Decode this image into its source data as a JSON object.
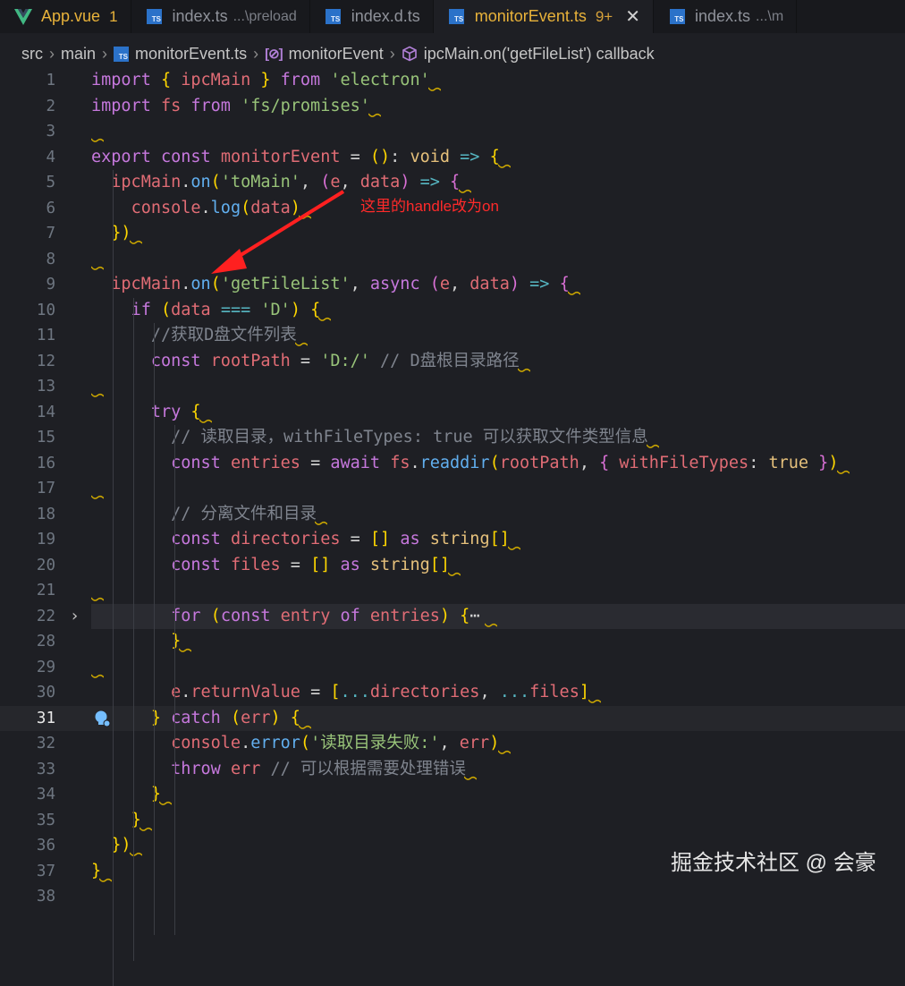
{
  "tabs": [
    {
      "title": "App.vue",
      "badge": "1",
      "icon": "vue-icon",
      "desc": "",
      "active": false
    },
    {
      "title": "index.ts",
      "badge": "",
      "icon": "ts-file-icon",
      "desc": "...\\preload",
      "active": false
    },
    {
      "title": "index.d.ts",
      "badge": "",
      "icon": "ts-file-icon",
      "desc": "",
      "active": false
    },
    {
      "title": "monitorEvent.ts",
      "badge": "9+",
      "icon": "ts-file-icon",
      "desc": "",
      "active": true
    },
    {
      "title": "index.ts",
      "badge": "",
      "icon": "ts-file-icon",
      "desc": "...\\m",
      "active": false
    }
  ],
  "ts_badge": "TS",
  "close_glyph": "✕",
  "breadcrumb": [
    "src",
    "main",
    "monitorEvent.ts",
    "monitorEvent",
    "ipcMain.on('getFileList') callback"
  ],
  "breadcrumb_sep": "›",
  "editor": {
    "current_line": "31",
    "folded_line": "22",
    "lines": [
      {
        "n": "1",
        "text": "import { ipcMain } from 'electron'"
      },
      {
        "n": "2",
        "text": "import fs from 'fs/promises'"
      },
      {
        "n": "3",
        "text": ""
      },
      {
        "n": "4",
        "text": "export const monitorEvent = (): void => {"
      },
      {
        "n": "5",
        "text": "  ipcMain.on('toMain', (e, data) => {"
      },
      {
        "n": "6",
        "text": "    console.log(data)"
      },
      {
        "n": "7",
        "text": "  })"
      },
      {
        "n": "8",
        "text": ""
      },
      {
        "n": "9",
        "text": "  ipcMain.on('getFileList', async (e, data) => {"
      },
      {
        "n": "10",
        "text": "    if (data === 'D') {"
      },
      {
        "n": "11",
        "text": "      //获取D盘文件列表"
      },
      {
        "n": "12",
        "text": "      const rootPath = 'D:/' // D盘根目录路径"
      },
      {
        "n": "13",
        "text": ""
      },
      {
        "n": "14",
        "text": "      try {"
      },
      {
        "n": "15",
        "text": "        // 读取目录，withFileTypes: true 可以获取文件类型信息"
      },
      {
        "n": "16",
        "text": "        const entries = await fs.readdir(rootPath, { withFileTypes: true })"
      },
      {
        "n": "17",
        "text": ""
      },
      {
        "n": "18",
        "text": "        // 分离文件和目录"
      },
      {
        "n": "19",
        "text": "        const directories = [] as string[]"
      },
      {
        "n": "20",
        "text": "        const files = [] as string[]"
      },
      {
        "n": "21",
        "text": ""
      },
      {
        "n": "22",
        "text": "        for (const entry of entries) {⋯"
      },
      {
        "n": "28",
        "text": "        }"
      },
      {
        "n": "29",
        "text": ""
      },
      {
        "n": "30",
        "text": "        e.returnValue = [...directories, ...files]"
      },
      {
        "n": "31",
        "text": "      } catch (err) {"
      },
      {
        "n": "32",
        "text": "        console.error('读取目录失败:', err)"
      },
      {
        "n": "33",
        "text": "        throw err // 可以根据需要处理错误"
      },
      {
        "n": "34",
        "text": "      }"
      },
      {
        "n": "35",
        "text": "    }"
      },
      {
        "n": "36",
        "text": "  })"
      },
      {
        "n": "37",
        "text": "}"
      },
      {
        "n": "38",
        "text": ""
      }
    ]
  },
  "annotation": "这里的handle改为on",
  "watermark": "掘金技术社区 @ 会豪",
  "colors": {
    "background": "#1e1f24",
    "annotation_red": "#ff2a2a",
    "keyword": "#c678dd",
    "string": "#98c379",
    "function": "#61afef",
    "variable": "#e06c75",
    "comment": "#7f848e"
  }
}
